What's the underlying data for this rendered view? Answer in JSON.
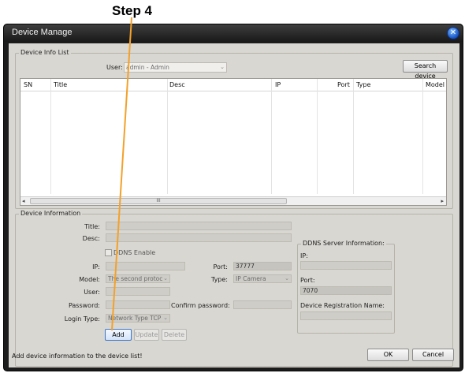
{
  "annotation": {
    "step_label": "Step 4",
    "arrow_color": "#f3a12a"
  },
  "window": {
    "title": "Device Manage",
    "close_glyph": "✕"
  },
  "device_info_list": {
    "legend": "Device Info List",
    "user_label": "User:",
    "user_value": "admin - Admin",
    "search_button": "Search device",
    "columns": [
      "SN",
      "Title",
      "Desc",
      "IP",
      "Port",
      "Type",
      "Model"
    ],
    "scroll_left": "◂",
    "scroll_right": "▸",
    "scroll_grip": "III"
  },
  "device_information": {
    "legend": "Device Information",
    "title_label": "Title:",
    "desc_label": "Desc:",
    "ddns_enable_label": "DDNS Enable",
    "ip_label": "IP:",
    "port_label": "Port:",
    "port_value": "37777",
    "model_label": "Model:",
    "model_value": "The second protoc",
    "type_label": "Type:",
    "type_value": "IP Camera",
    "user_label": "User:",
    "password_label": "Password:",
    "confirm_password_label": "Confirm password:",
    "login_type_label": "Login Type:",
    "login_type_value": "Network Type TCP",
    "add_button": "Add",
    "update_button": "Update",
    "delete_button": "Delete"
  },
  "ddns": {
    "legend": "DDNS Server Information:",
    "ip_label": "IP:",
    "port_label": "Port:",
    "port_value": "7070",
    "registration_label": "Device Registration Name:"
  },
  "footer": {
    "status_text": "Add device information to the device list!",
    "ok_button": "OK",
    "cancel_button": "Cancel"
  }
}
